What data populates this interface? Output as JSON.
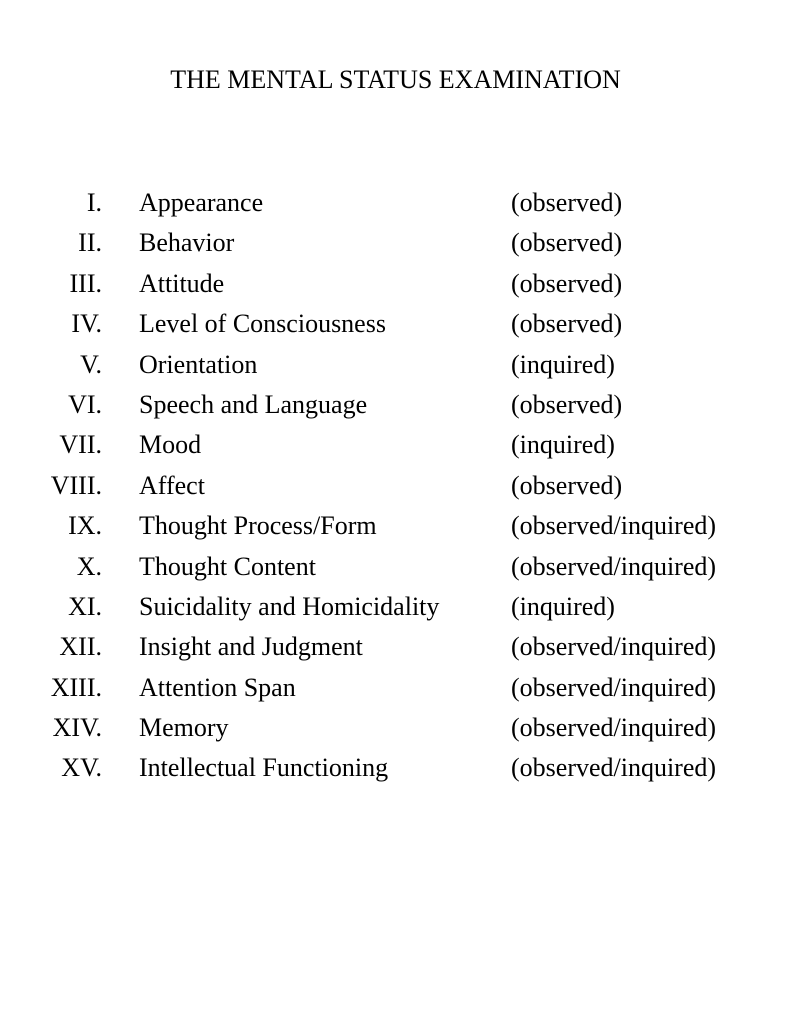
{
  "document": {
    "title": "THE MENTAL STATUS EXAMINATION",
    "items": [
      {
        "numeral": "I.",
        "name": "Appearance",
        "method": "(observed)"
      },
      {
        "numeral": "II.",
        "name": "Behavior",
        "method": "(observed)"
      },
      {
        "numeral": "III.",
        "name": "Attitude",
        "method": "(observed)"
      },
      {
        "numeral": "IV.",
        "name": "Level of Consciousness",
        "method": "(observed)"
      },
      {
        "numeral": "V.",
        "name": "Orientation",
        "method": "(inquired)"
      },
      {
        "numeral": "VI.",
        "name": "Speech and Language",
        "method": "(observed)"
      },
      {
        "numeral": "VII.",
        "name": "Mood",
        "method": "(inquired)"
      },
      {
        "numeral": "VIII.",
        "name": "Affect",
        "method": "(observed)"
      },
      {
        "numeral": "IX.",
        "name": "Thought Process/Form",
        "method": "(observed/inquired)"
      },
      {
        "numeral": "X.",
        "name": "Thought Content",
        "method": "(observed/inquired)"
      },
      {
        "numeral": "XI.",
        "name": "Suicidality and Homicidality",
        "method": "(inquired)"
      },
      {
        "numeral": "XII.",
        "name": "Insight and Judgment",
        "method": "(observed/inquired)"
      },
      {
        "numeral": "XIII.",
        "name": "Attention Span",
        "method": "(observed/inquired)"
      },
      {
        "numeral": "XIV.",
        "name": "Memory",
        "method": "(observed/inquired)"
      },
      {
        "numeral": "XV.",
        "name": "Intellectual Functioning",
        "method": "(observed/inquired)"
      }
    ]
  }
}
